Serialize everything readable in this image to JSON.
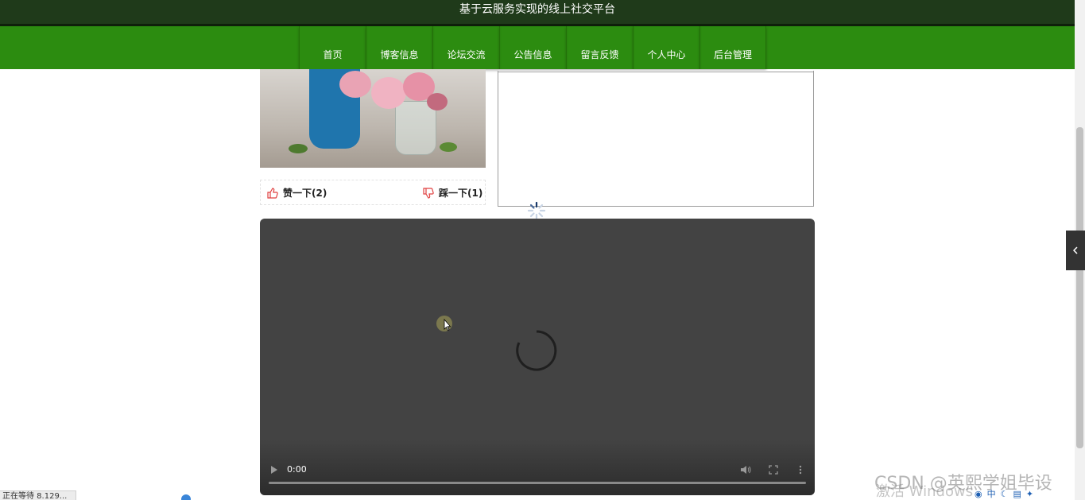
{
  "header": {
    "site_title": "基于云服务实现的线上社交平台"
  },
  "nav": {
    "items": [
      {
        "label": "首页"
      },
      {
        "label": "博客信息"
      },
      {
        "label": "论坛交流"
      },
      {
        "label": "公告信息"
      },
      {
        "label": "留言反馈"
      },
      {
        "label": "个人中心"
      },
      {
        "label": "后台管理"
      }
    ]
  },
  "post": {
    "like_label": "赞一下(2)",
    "dislike_label": "踩一下(1)"
  },
  "video": {
    "current_time": "0:00",
    "progress": 0
  },
  "status_bar": {
    "text": "正在等待 8.129..."
  },
  "watermark": {
    "text": "CSDN @英熙学姐毕设",
    "activate_text": "激活 Windows"
  },
  "tray": {
    "ime_label": "中"
  },
  "colors": {
    "header_bg": "#1f3a1a",
    "nav_bg": "#2c8c10",
    "video_bg": "#434343",
    "vote_icon": "#e04040"
  },
  "icons": {
    "like": "thumbs-up-icon",
    "dislike": "thumbs-down-icon",
    "play": "play-icon",
    "volume": "volume-icon",
    "fullscreen": "fullscreen-icon",
    "more": "more-vertical-icon",
    "side_tab": "chevron-left-icon"
  }
}
